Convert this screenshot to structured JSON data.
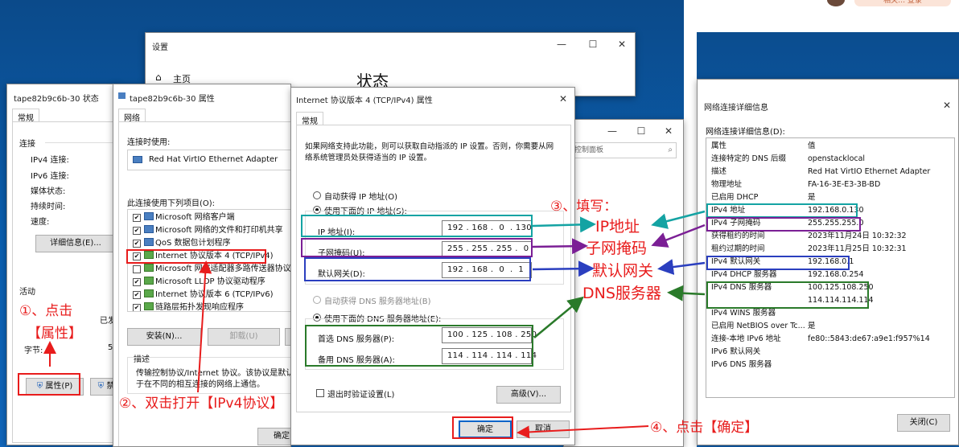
{
  "browser": {
    "top_pill": "相关… 登录"
  },
  "settings_window": {
    "title": "设置",
    "home_label": "主页",
    "heading": "状态",
    "controls": [
      "—",
      "☐",
      "✕"
    ]
  },
  "status_window": {
    "title": "tape82b9c6b-30 状态",
    "tab": "常规",
    "section_connection": "连接",
    "rows": [
      "IPv4 连接:",
      "IPv6 连接:",
      "媒体状态:",
      "持续时间:",
      "速度:"
    ],
    "details_button": "详细信息(E)...",
    "section_activity": "活动",
    "sent_label": "已发送",
    "bytes_label": "字节:",
    "bytes_value": "5,1",
    "properties_button": "属性(P)",
    "disable_button": "禁"
  },
  "props_window": {
    "title": "tape82b9c6b-30 属性",
    "tab": "网络",
    "connect_using_label": "连接时使用:",
    "adapter_name": "Red Hat VirtIO Ethernet Adapter",
    "items_label": "此连接使用下列项目(O):",
    "items": [
      "Microsoft 网络客户端",
      "Microsoft 网络的文件和打印机共享",
      "QoS 数据包计划程序",
      "Internet 协议版本 4 (TCP/IPv4)",
      "Microsoft 网络适配器多路传送器协议",
      "Microsoft LLDP 协议驱动程序",
      "Internet 协议版本 6 (TCP/IPv6)",
      "链路层拓扑发现响应程序"
    ],
    "install_button": "安装(N)...",
    "uninstall_button": "卸载(U)",
    "desc_title": "描述",
    "desc_text_1": "传输控制协议/Internet 协议。该协议是默认的",
    "desc_text_2": "于在不同的相互连接的网络上通信。",
    "ok_button": "确定"
  },
  "ipv4_dialog": {
    "title": "Internet 协议版本 4 (TCP/IPv4) 属性",
    "tab": "常规",
    "intro_1": "如果网络支持此功能，则可以获取自动指派的 IP 设置。否则，你需要从网",
    "intro_2": "络系统管理员处获得适当的 IP 设置。",
    "auto_ip": "自动获得 IP 地址(O)",
    "manual_ip": "使用下面的 IP 地址(S):",
    "ip_label": "IP 地址(I):",
    "ip_value": "192 . 168 .  0  . 130",
    "mask_label": "子网掩码(U):",
    "mask_value": "255 . 255 . 255 .  0",
    "gateway_label": "默认网关(D):",
    "gateway_value": "192 . 168 .  0  .  1",
    "auto_dns": "自动获得 DNS 服务器地址(B)",
    "manual_dns": "使用下面的 DNS 服务器地址(E):",
    "pref_dns_label": "首选 DNS 服务器(P):",
    "pref_dns_value": "100 . 125 . 108 . 250",
    "alt_dns_label": "备用 DNS 服务器(A):",
    "alt_dns_value": "114 . 114 . 114 . 114",
    "validate_label": "退出时验证设置(L)",
    "advanced_button": "高级(V)...",
    "ok_button": "确定",
    "cancel_button": "取消"
  },
  "control_panel_window": {
    "search_placeholder": "控制面板",
    "controls": [
      "—",
      "☐",
      "✕"
    ]
  },
  "details_window": {
    "title": "网络连接详细信息",
    "label": "网络连接详细信息(D):",
    "col_property": "属性",
    "col_value": "值",
    "rows": [
      {
        "k": "连接特定的 DNS 后缀",
        "v": "openstacklocal"
      },
      {
        "k": "描述",
        "v": "Red Hat VirtIO Ethernet Adapter"
      },
      {
        "k": "物理地址",
        "v": "FA-16-3E-E3-3B-BD"
      },
      {
        "k": "已启用 DHCP",
        "v": "是"
      },
      {
        "k": "IPv4 地址",
        "v": "192.168.0.130"
      },
      {
        "k": "IPv4 子网掩码",
        "v": "255.255.255.0"
      },
      {
        "k": "获得租约的时间",
        "v": "2023年11月24日 10:32:32"
      },
      {
        "k": "租约过期的时间",
        "v": "2023年11月25日 10:32:31"
      },
      {
        "k": "IPv4 默认网关",
        "v": "192.168.0.1"
      },
      {
        "k": "IPv4 DHCP 服务器",
        "v": "192.168.0.254"
      },
      {
        "k": "IPv4 DNS 服务器",
        "v": "100.125.108.250"
      },
      {
        "k": "",
        "v": "114.114.114.114"
      },
      {
        "k": "IPv4 WINS 服务器",
        "v": ""
      },
      {
        "k": "已启用 NetBIOS over Tc...",
        "v": "是"
      },
      {
        "k": "连接-本地 IPv6 地址",
        "v": "fe80::5843:de67:a9e1:f957%14"
      },
      {
        "k": "IPv6 默认网关",
        "v": ""
      },
      {
        "k": "IPv6 DNS 服务器",
        "v": ""
      }
    ],
    "close_button": "关闭(C)"
  },
  "annotations": {
    "step1_a": "①、点击",
    "step1_b": "【属性】",
    "step2": "②、双击打开【IPv4协议】",
    "step3": "③、填写：",
    "ip": "IP地址",
    "mask": "子网掩码",
    "gateway": "默认网关",
    "dns": "DNS服务器",
    "step4": "④、点击【确定】"
  },
  "colors": {
    "red": "#e81c1c",
    "teal": "#14a3a3",
    "purple": "#7b1f95",
    "blue": "#2b3fbf",
    "green": "#2a7a2a"
  }
}
